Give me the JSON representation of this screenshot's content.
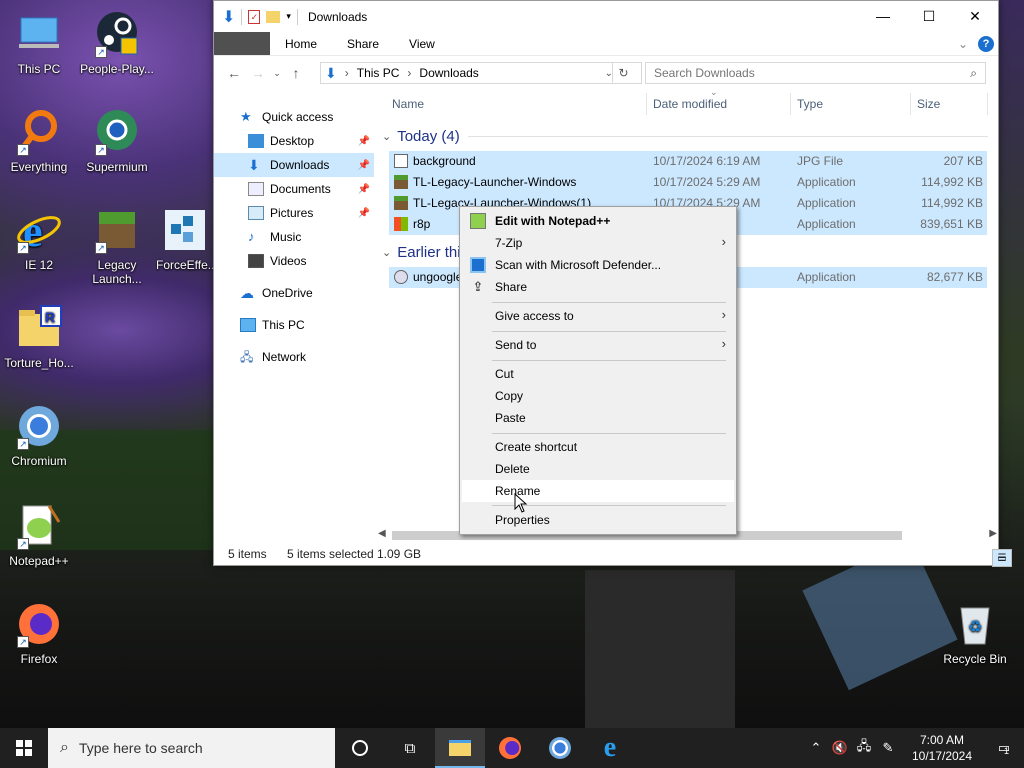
{
  "desktop": {
    "icons_left": [
      {
        "label": "This PC",
        "icon": "this-pc-icon"
      },
      {
        "label": "People-Play...",
        "icon": "steam-icon"
      },
      {
        "label": "Everything",
        "icon": "everything-search-icon"
      },
      {
        "label": "Supermium",
        "icon": "supermium-icon"
      },
      {
        "label": "IE 12",
        "icon": "internet-explorer-icon"
      },
      {
        "label": "Legacy Launch...",
        "icon": "minecraft-block-icon"
      },
      {
        "label": "ForceEffe...",
        "icon": "force-effect-icon"
      },
      {
        "label": "Torture_Ho...",
        "icon": "folder-icon"
      },
      {
        "label": "Chromium",
        "icon": "chromium-icon"
      },
      {
        "label": "Notepad++",
        "icon": "notepadpp-icon"
      },
      {
        "label": "Firefox",
        "icon": "firefox-icon"
      },
      {
        "label": "Recycle Bin",
        "icon": "recycle-bin-icon"
      }
    ]
  },
  "explorer": {
    "title": "Downloads",
    "ribbon_tabs": [
      "Home",
      "Share",
      "View"
    ],
    "address": {
      "segments": [
        "This PC",
        "Downloads"
      ]
    },
    "search_placeholder": "Search Downloads",
    "nav": [
      {
        "label": "Quick access",
        "icon": "star-icon"
      },
      {
        "label": "Desktop",
        "icon": "desktop-icon",
        "pinned": true
      },
      {
        "label": "Downloads",
        "icon": "download-icon",
        "pinned": true,
        "selected": true
      },
      {
        "label": "Documents",
        "icon": "documents-icon",
        "pinned": true
      },
      {
        "label": "Pictures",
        "icon": "pictures-icon",
        "pinned": true
      },
      {
        "label": "Music",
        "icon": "music-icon"
      },
      {
        "label": "Videos",
        "icon": "videos-icon"
      },
      {
        "label": "OneDrive",
        "icon": "onedrive-icon"
      },
      {
        "label": "This PC",
        "icon": "this-pc-icon"
      },
      {
        "label": "Network",
        "icon": "network-icon"
      }
    ],
    "columns": [
      "Name",
      "Date modified",
      "Type",
      "Size"
    ],
    "groups": [
      {
        "label": "Today (4)"
      },
      {
        "label": "Earlier thi"
      }
    ],
    "files": [
      {
        "name": "background",
        "date": "10/17/2024 6:19 AM",
        "type": "JPG File",
        "size": "207 KB",
        "icon": "image-file-icon"
      },
      {
        "name": "TL-Legacy-Launcher-Windows",
        "date": "10/17/2024 5:29 AM",
        "type": "Application",
        "size": "114,992 KB",
        "icon": "minecraft-block-icon"
      },
      {
        "name": "TL-Legacy-Launcher-Windows(1)",
        "date": "10/17/2024 5:29 AM",
        "type": "Application",
        "size": "114,992 KB",
        "icon": "minecraft-block-icon"
      },
      {
        "name": "r8p",
        "date": "",
        "type": "Application",
        "size": "839,651 KB",
        "icon": "windows-installer-icon"
      },
      {
        "name": "ungoogle",
        "date": "AM",
        "type": "Application",
        "size": "82,677 KB",
        "icon": "chromium-installer-icon"
      }
    ],
    "status": {
      "items": "5 items",
      "selected": "5 items selected",
      "size": "1.09 GB"
    }
  },
  "context_menu": {
    "items": [
      {
        "label": "Edit with Notepad++",
        "icon": "notepadpp-icon",
        "bold": true
      },
      {
        "label": "7-Zip",
        "submenu": true
      },
      {
        "label": "Scan with Microsoft Defender...",
        "icon": "defender-icon"
      },
      {
        "label": "Share",
        "icon": "share-icon"
      },
      {
        "label": "Give access to",
        "submenu": true
      },
      {
        "label": "Send to",
        "submenu": true
      },
      {
        "label": "Cut"
      },
      {
        "label": "Copy"
      },
      {
        "label": "Paste"
      },
      {
        "label": "Create shortcut"
      },
      {
        "label": "Delete"
      },
      {
        "label": "Rename",
        "hovered": true
      },
      {
        "label": "Properties"
      }
    ]
  },
  "taskbar": {
    "search_placeholder": "Type here to search",
    "time": "7:00 AM",
    "date": "10/17/2024",
    "notification_count": "1"
  }
}
